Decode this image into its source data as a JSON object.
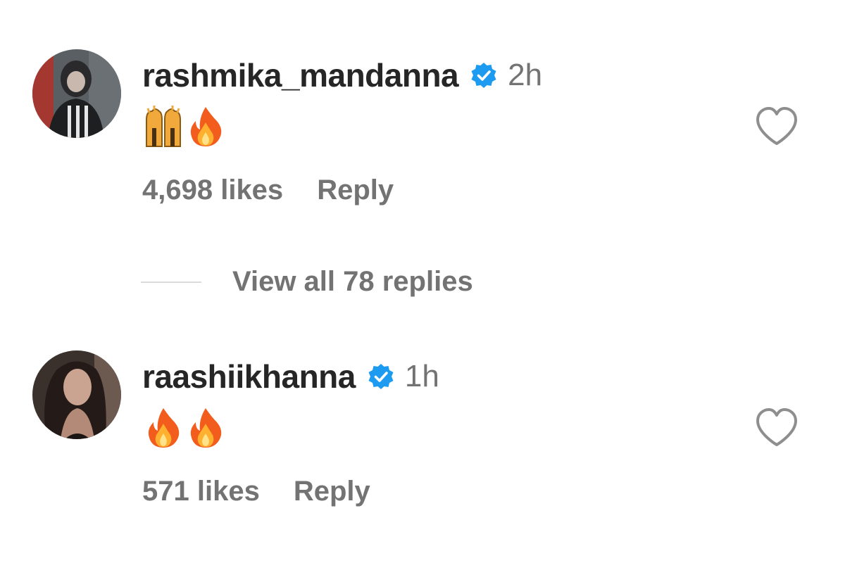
{
  "comments": [
    {
      "username": "rashmika_mandanna",
      "verified": true,
      "time": "2h",
      "emojis": [
        "raised-hands",
        "fire"
      ],
      "likes": "4,698 likes",
      "reply_label": "Reply",
      "view_replies": "View all 78 replies"
    },
    {
      "username": "raashiikhanna",
      "verified": true,
      "time": "1h",
      "emojis": [
        "fire",
        "fire"
      ],
      "likes": "571 likes",
      "reply_label": "Reply"
    }
  ],
  "colors": {
    "verified_badge": "#1d9bf0",
    "secondary_text": "#737373",
    "primary_text": "#262626",
    "divider": "#dbdbdb"
  },
  "icons": {
    "verified": "verified-badge-icon",
    "like": "heart-outline-icon"
  }
}
